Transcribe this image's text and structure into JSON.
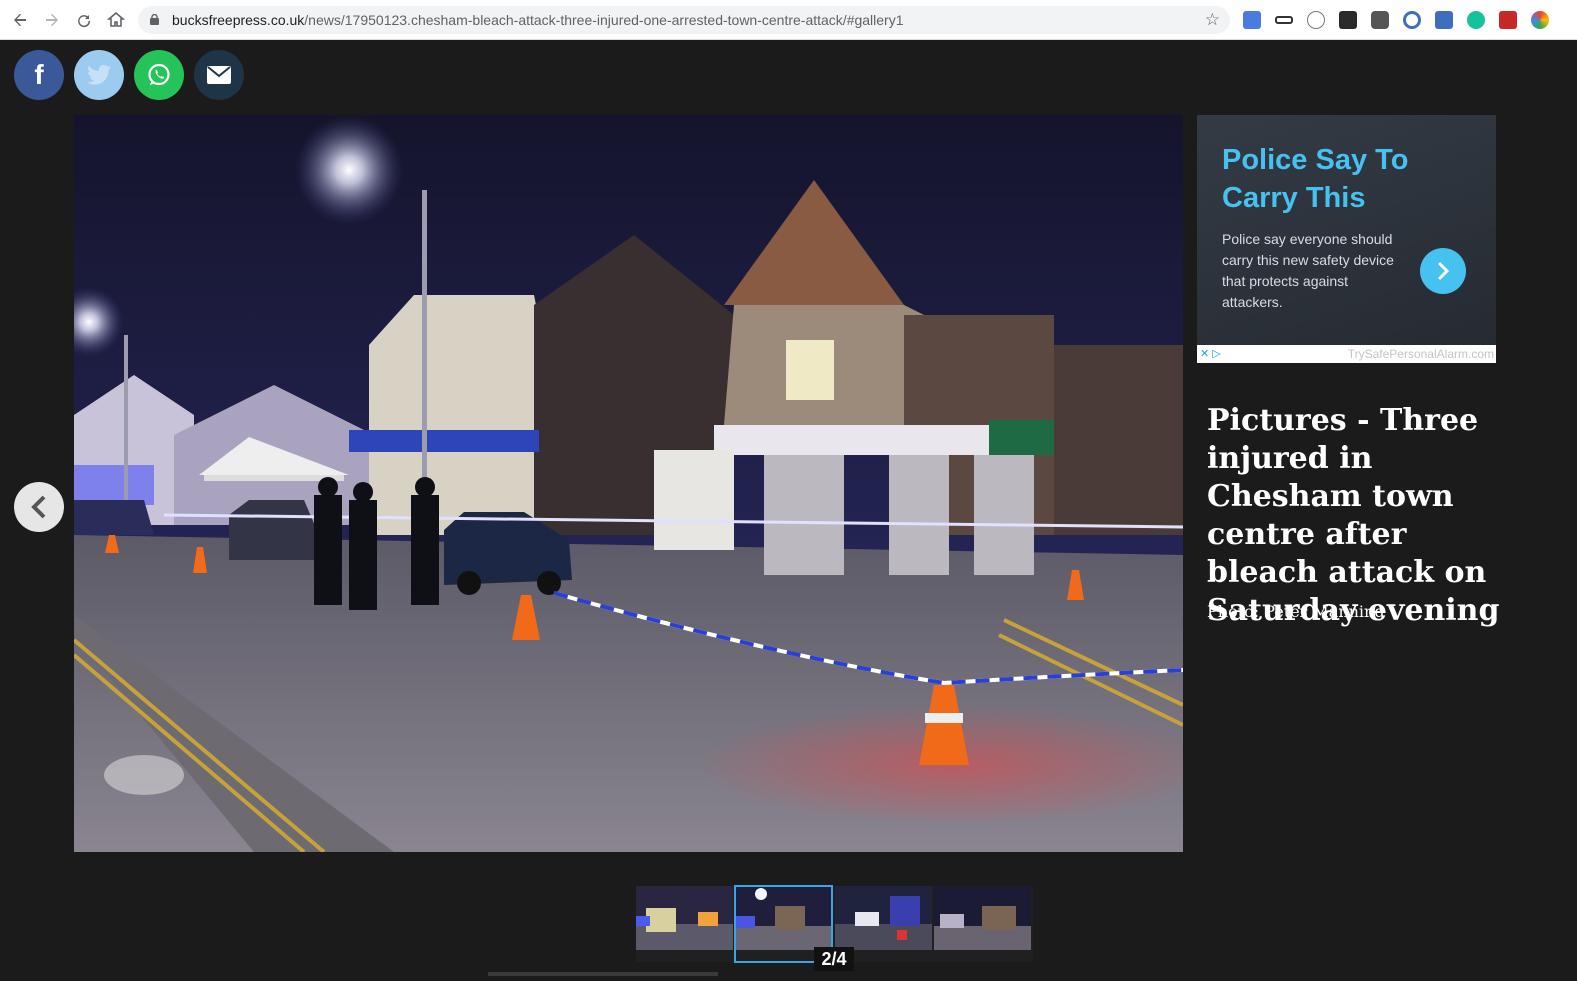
{
  "browser": {
    "url_domain": "bucksfreepress.co.uk",
    "url_path": "/news/17950123.chesham-bleach-attack-three-injured-one-arrested-town-centre-attack/#gallery1",
    "back_icon": "arrow-left-icon",
    "forward_icon": "arrow-right-icon",
    "reload_icon": "reload-icon",
    "home_icon": "home-icon",
    "bookmark_icon": "star-icon"
  },
  "share": [
    {
      "name": "facebook",
      "glyph": "f",
      "color": "#3b5998"
    },
    {
      "name": "twitter",
      "glyph": "",
      "color": "#9ccbf0"
    },
    {
      "name": "whatsapp",
      "glyph": "",
      "color": "#25c45a"
    },
    {
      "name": "email",
      "glyph": "",
      "color": "#1d3546"
    }
  ],
  "ad": {
    "title": "Police Say To Carry This",
    "body": "Police say everyone should carry this new safety device that protects against attackers.",
    "domain": "TrySafePersonalAlarm.com",
    "accent": "#45c2ef"
  },
  "gallery": {
    "caption": "Pictures - Three injured in Chesham town centre after bleach attack on Saturday evening",
    "credit": "Photo: Peter Manning",
    "counter": "2/4",
    "current": 2,
    "total": 4
  }
}
